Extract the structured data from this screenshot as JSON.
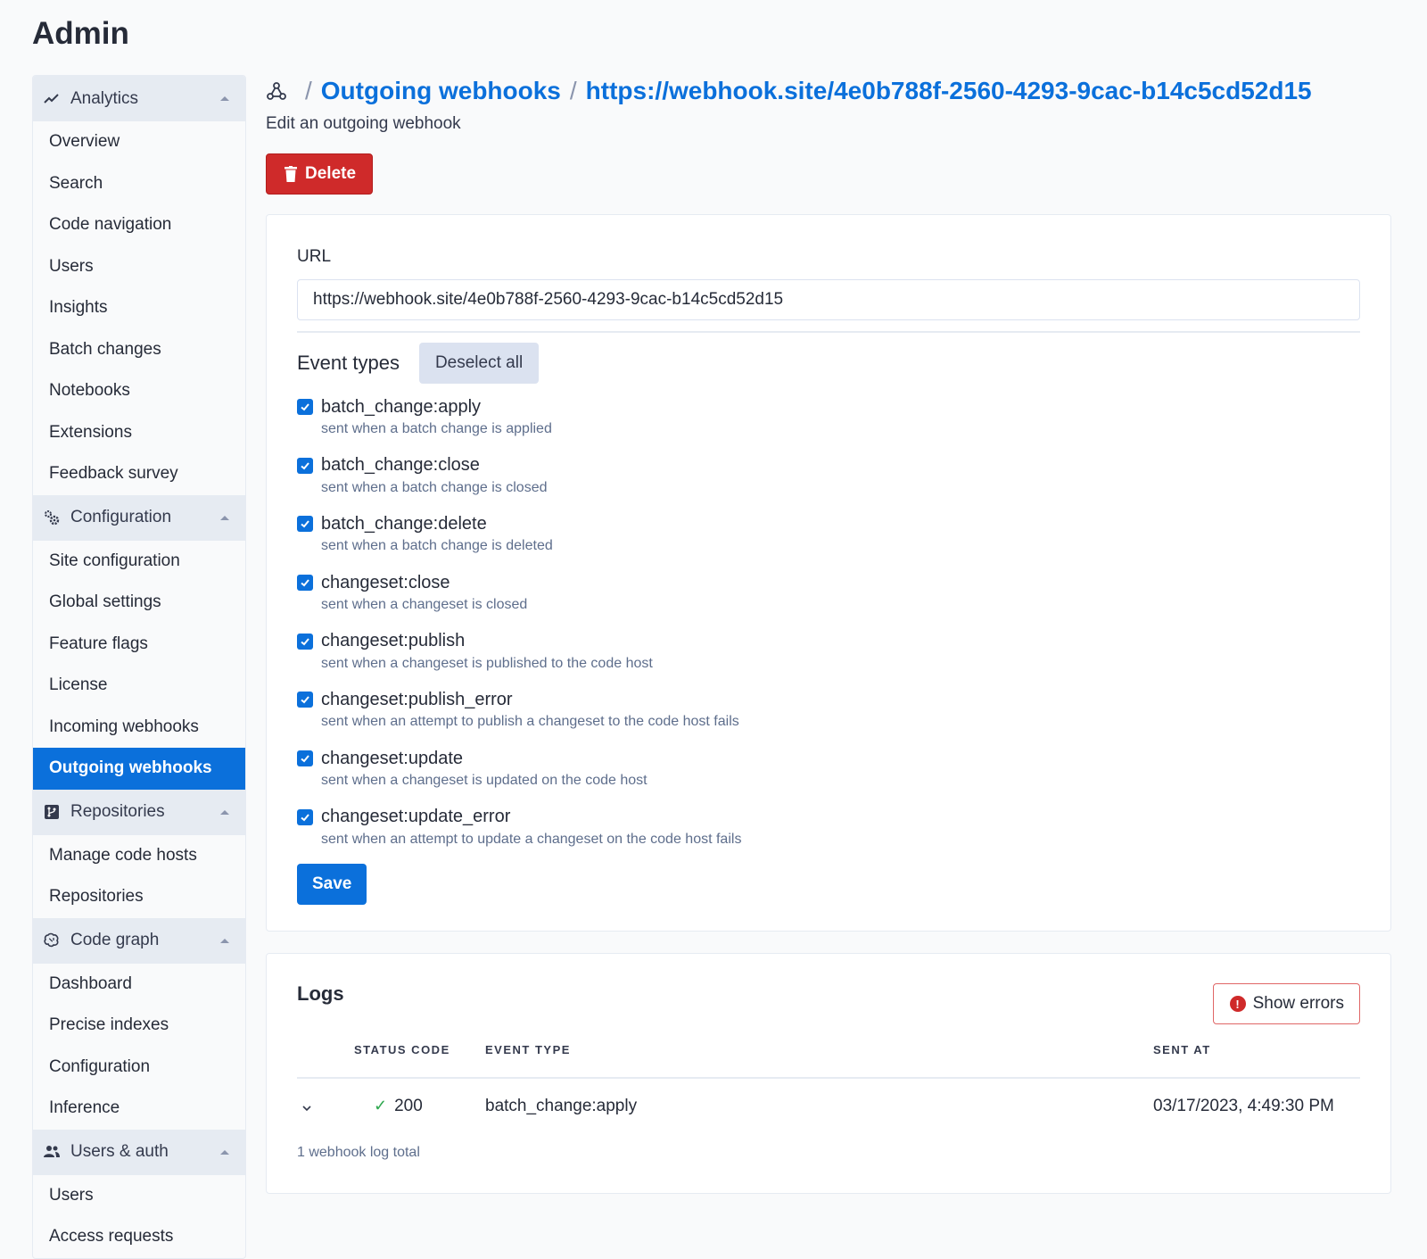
{
  "page": {
    "title": "Admin"
  },
  "sidebar": {
    "groups": [
      {
        "label": "Analytics",
        "icon": "chart-line-icon",
        "items": [
          "Overview",
          "Search",
          "Code navigation",
          "Users",
          "Insights",
          "Batch changes",
          "Notebooks",
          "Extensions",
          "Feedback survey"
        ]
      },
      {
        "label": "Configuration",
        "icon": "cogs-icon",
        "items": [
          "Site configuration",
          "Global settings",
          "Feature flags",
          "License",
          "Incoming webhooks",
          "Outgoing webhooks"
        ]
      },
      {
        "label": "Repositories",
        "icon": "source-repository-icon",
        "items": [
          "Manage code hosts",
          "Repositories"
        ]
      },
      {
        "label": "Code graph",
        "icon": "brain-icon",
        "items": [
          "Dashboard",
          "Precise indexes",
          "Configuration",
          "Inference"
        ]
      },
      {
        "label": "Users & auth",
        "icon": "account-multiple-icon",
        "items": [
          "Users",
          "Access requests"
        ]
      }
    ],
    "active_item": "Outgoing webhooks"
  },
  "breadcrumb": {
    "icon": "webhook-icon",
    "separator": "/",
    "items": [
      "Outgoing webhooks",
      "https://webhook.site/4e0b788f-2560-4293-9cac-b14c5cd52d15"
    ]
  },
  "subtitle": "Edit an outgoing webhook",
  "delete_button": "Delete",
  "form": {
    "url_label": "URL",
    "url_value": "https://webhook.site/4e0b788f-2560-4293-9cac-b14c5cd52d15",
    "event_types_heading": "Event types",
    "deselect_all": "Deselect all",
    "events": [
      {
        "name": "batch_change:apply",
        "description": "sent when a batch change is applied",
        "checked": true
      },
      {
        "name": "batch_change:close",
        "description": "sent when a batch change is closed",
        "checked": true
      },
      {
        "name": "batch_change:delete",
        "description": "sent when a batch change is deleted",
        "checked": true
      },
      {
        "name": "changeset:close",
        "description": "sent when a changeset is closed",
        "checked": true
      },
      {
        "name": "changeset:publish",
        "description": "sent when a changeset is published to the code host",
        "checked": true
      },
      {
        "name": "changeset:publish_error",
        "description": "sent when an attempt to publish a changeset to the code host fails",
        "checked": true
      },
      {
        "name": "changeset:update",
        "description": "sent when a changeset is updated on the code host",
        "checked": true
      },
      {
        "name": "changeset:update_error",
        "description": "sent when an attempt to update a changeset on the code host fails",
        "checked": true
      }
    ],
    "save": "Save"
  },
  "logs": {
    "title": "Logs",
    "show_errors": "Show errors",
    "columns": {
      "status": "STATUS CODE",
      "event": "EVENT TYPE",
      "sent_at": "SENT AT"
    },
    "rows": [
      {
        "status": "200",
        "event": "batch_change:apply",
        "sent_at": "03/17/2023, 4:49:30 PM"
      }
    ],
    "total": "1 webhook log total"
  },
  "colors": {
    "primary": "#0b70db",
    "danger": "#cf2a2a",
    "success": "#2fa84f"
  }
}
